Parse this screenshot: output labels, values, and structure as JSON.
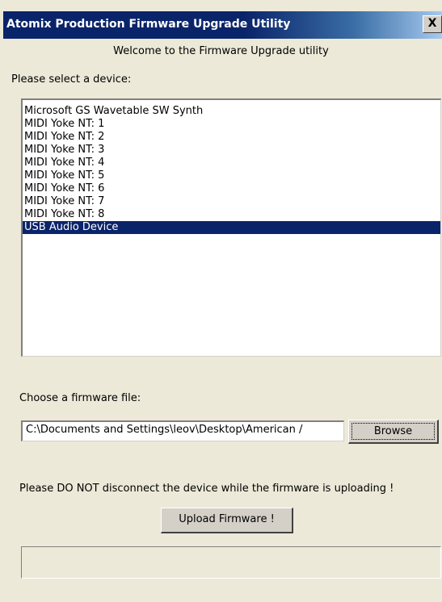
{
  "window": {
    "title": "Atomix Production Firmware Upgrade Utility",
    "close_label": "X"
  },
  "welcome_text": "Welcome to the Firmware Upgrade utility",
  "device_section": {
    "label": "Please select a device:",
    "items": [
      "Microsoft GS Wavetable SW Synth",
      "MIDI Yoke NT:  1",
      "MIDI Yoke NT:  2",
      "MIDI Yoke NT:  3",
      "MIDI Yoke NT:  4",
      "MIDI Yoke NT:  5",
      "MIDI Yoke NT:  6",
      "MIDI Yoke NT:  7",
      "MIDI Yoke NT:  8",
      "USB Audio Device"
    ],
    "selected_index": 9
  },
  "firmware_section": {
    "label": "Choose a firmware file:",
    "file_path": "C:\\Documents and Settings\\leov\\Desktop\\American /",
    "browse_label": "Browse"
  },
  "warning_text": "Please DO NOT disconnect the device while the firmware is uploading !",
  "upload_label": "Upload Firmware !",
  "progress_fraction": 0,
  "colors": {
    "title_bar": "#0a246a",
    "selection": "#0a246a",
    "window_bg": "#ece9d8"
  }
}
